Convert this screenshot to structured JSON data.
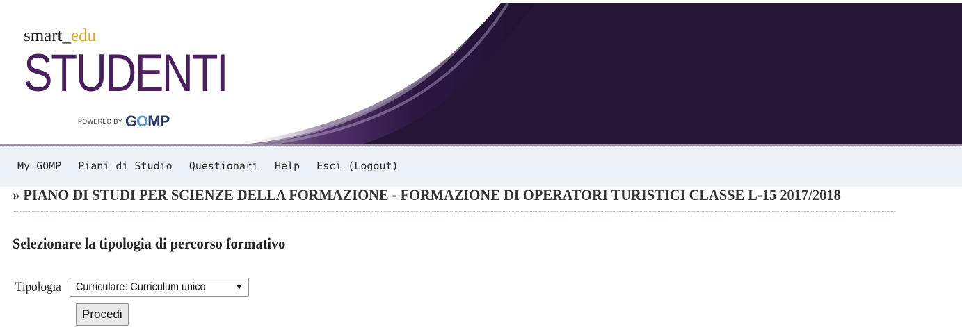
{
  "brand": {
    "logo_prefix": "smart_",
    "logo_accent": "edu",
    "logo_main": "STUDENTI",
    "powered_by": "POWERED BY",
    "powered_brand_1": "G",
    "powered_brand_2": "O",
    "powered_brand_3": "MP"
  },
  "nav": {
    "items": [
      {
        "label": "My GOMP"
      },
      {
        "label": "Piani di Studio"
      },
      {
        "label": "Questionari"
      },
      {
        "label": "Help"
      },
      {
        "label": "Esci (Logout)"
      }
    ]
  },
  "page": {
    "title": "» PIANO DI STUDI PER SCIENZE DELLA FORMAZIONE - FORMAZIONE DI OPERATORI TURISTICI CLASSE L-15 2017/2018",
    "heading": "Selezionare la tipologia di percorso formativo"
  },
  "form": {
    "tipologia_label": "Tipologia",
    "tipologia_selected": "Curriculare: Curriculum unico",
    "submit_label": "Procedi"
  },
  "colors": {
    "banner_dark": "#231337",
    "banner_mid": "#3a1c55",
    "logo_purple": "#4a1f5e",
    "accent_gold": "#e0a72a",
    "navbar_bg": "#edf2f8"
  },
  "icons": {
    "select_arrow": "dropdown-arrow-icon"
  }
}
